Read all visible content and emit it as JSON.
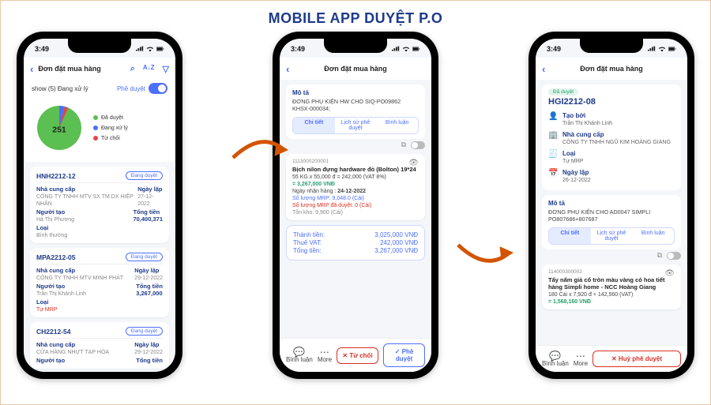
{
  "page_title": "MOBILE APP DUYỆT P.O",
  "status_time": "3:49",
  "nav_title": "Đơn đặt mua hàng",
  "phone1": {
    "filter_label": "show (5) Đang xử lý",
    "approve_mode_label": "Phê duyệt",
    "legend": {
      "approved": "Đã duyệt",
      "processing": "Đang xử lý",
      "rejected": "Từ chối"
    },
    "chart_data": {
      "type": "pie",
      "series": [
        {
          "name": "Đã duyệt",
          "value": 251,
          "color": "#5bbf52"
        },
        {
          "name": "Đang xử lý",
          "value": 5,
          "color": "#4c6fff"
        },
        {
          "name": "Từ chối",
          "value": 3,
          "color": "#e64545"
        }
      ],
      "center_label": "251"
    },
    "cards": [
      {
        "id": "HNH2212-12",
        "status": "Đang duyệt",
        "supplier_label": "Nhà cung cấp",
        "supplier": "CÔNG TY TNHH MTV SX TM DX HIỆP NHÂN",
        "date_label": "Ngày lập",
        "date": "27-12-2022",
        "creator_label": "Người tạo",
        "creator": "Hà Thị Phương",
        "total_label": "Tổng tiền",
        "total": "70,400,371",
        "type_label": "Loại",
        "type": "Bình thường"
      },
      {
        "id": "MPA2212-05",
        "status": "Đang duyệt",
        "supplier_label": "Nhà cung cấp",
        "supplier": "CÔNG TY TNHH MTV MINH PHÁT",
        "date_label": "Ngày lập",
        "date": "29-12-2022",
        "creator_label": "Người tạo",
        "creator": "Trần Thị Khánh Linh",
        "total_label": "Tổng tiền",
        "total": "3,267,000",
        "type_label": "Loại",
        "type": "Tự MRP"
      },
      {
        "id": "CH2212-54",
        "status": "Đang duyệt",
        "supplier_label": "Nhà cung cấp",
        "supplier": "CỬA HÀNG NHỰT TẠP HÓA",
        "date_label": "Ngày lập",
        "date": "29-12-2022",
        "creator_label": "Người tạo",
        "total_label": "Tổng tiền"
      }
    ]
  },
  "phone2": {
    "desc_label": "Mô tả",
    "desc": "ĐƠNG PHỤ KIỆN HW CHO SIQ-PO09862 KHSX-000034;",
    "tabs": {
      "detail": "Chi tiết",
      "history": "Lịch sử phê duyệt",
      "comment": "Bình luận"
    },
    "line": {
      "sn": "1113000200001",
      "name": "Bịch nilon đựng hardware đỏ (Bolton) 19*24",
      "qty_calc": "55 KG x 55,000 đ = 242,000 (VAT 8%)",
      "subtotal": "= 3,267,000 VNĐ",
      "recv_label": "Ngày nhận hàng :",
      "recv_date": "24-12-2022",
      "mrp_note": "Số lượng MRP: 9,048.0 (Cái)",
      "approved_note": "Số lượng MRP đã duyệt: 0 (Cái)",
      "stock_note": "Tồn kho: 9,900 (Cái)"
    },
    "totals": {
      "subtotal_label": "Thành tiền:",
      "subtotal": "3,025,000 VNĐ",
      "vat_label": "Thuế VAT:",
      "vat": "242,000 VNĐ",
      "grand_label": "Tổng tiền:",
      "grand": "3,267,000 VNĐ"
    },
    "footer": {
      "comment": "Bình luận",
      "more": "More",
      "reject": "✕ Từ chối",
      "approve": "✓ Phê duyệt"
    }
  },
  "phone3": {
    "status_badge": "Đã duyệt",
    "po_id": "HGI2212-08",
    "info": {
      "creator_label": "Tạo bởi",
      "creator": "Trần Thị Khánh Linh",
      "supplier_label": "Nhà cung cấp",
      "supplier": "CÔNG TY TNHH NGŨ KIM HOÀNG GIANG",
      "type_label": "Loại",
      "type": "Tự MRP",
      "date_label": "Ngày lập",
      "date": "26-12-2022"
    },
    "desc_label": "Mô tả",
    "desc": "ĐƠNG PHỤ KIỆN CHO AD0047 SIMPLI PO807686+807687",
    "tabs": {
      "detail": "Chi tiết",
      "history": "Lịch sử phê duyệt",
      "comment": "Bình luận"
    },
    "line": {
      "sn": "114000300002",
      "name": "Tẩy nấm giả cổ tròn màu vàng có hoa tiết hàng Simpli home - NCC Hoàng Giang",
      "qty_calc": "180 Cái x 7,920 đ + 142,560 (VAT)",
      "subtotal": "= 1,568,160 VNĐ"
    },
    "footer": {
      "comment": "Bình luận",
      "more": "More",
      "cancel": "✕ Huỷ phê duyệt"
    }
  }
}
